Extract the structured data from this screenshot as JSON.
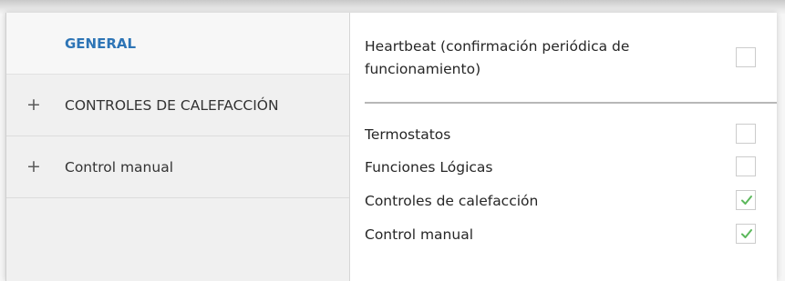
{
  "sidebar": {
    "items": [
      {
        "label": "GENERAL",
        "prefix": ""
      },
      {
        "label": "CONTROLES DE CALEFACCIÓN",
        "prefix": "+"
      },
      {
        "label": "Control manual",
        "prefix": "+"
      }
    ]
  },
  "settings": {
    "heartbeat": {
      "line1": "Heartbeat (confirmación periódica de",
      "line2": "funcionamiento)",
      "checked": false
    },
    "rows": [
      {
        "label": "Termostatos",
        "checked": false
      },
      {
        "label": "Funciones Lógicas",
        "checked": false
      },
      {
        "label": "Controles de calefacción",
        "checked": true
      },
      {
        "label": "Control manual",
        "checked": true
      }
    ]
  },
  "colors": {
    "accent": "#2e75b6",
    "check": "#5cb85c"
  }
}
